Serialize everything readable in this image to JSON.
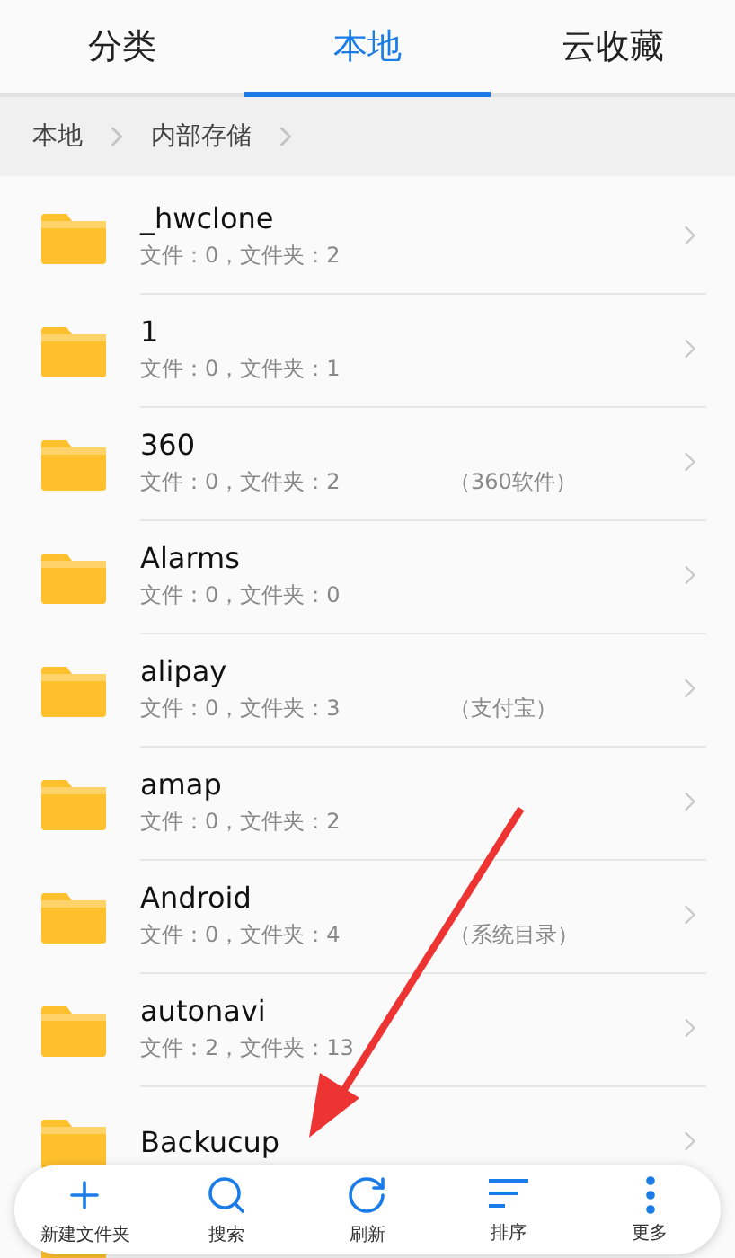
{
  "tabs": [
    {
      "label": "分类",
      "selected": false
    },
    {
      "label": "本地",
      "selected": true
    },
    {
      "label": "云收藏",
      "selected": false
    }
  ],
  "breadcrumb": [
    "本地",
    "内部存储"
  ],
  "folders": [
    {
      "name": "_hwclone",
      "info": "文件：0，文件夹：2"
    },
    {
      "name": "1",
      "info": "文件：0，文件夹：1"
    },
    {
      "name": "360",
      "info": "文件：0，文件夹：2",
      "tag": "（360软件）"
    },
    {
      "name": "Alarms",
      "info": "文件：0，文件夹：0"
    },
    {
      "name": "alipay",
      "info": "文件：0，文件夹：3",
      "tag": "（支付宝）"
    },
    {
      "name": "amap",
      "info": "文件：0，文件夹：2"
    },
    {
      "name": "Android",
      "info": "文件：0，文件夹：4",
      "tag": "（系统目录）"
    },
    {
      "name": "autonavi",
      "info": "文件：2，文件夹：13"
    },
    {
      "name": "Backucup"
    }
  ],
  "toolbar": [
    {
      "kind": "add",
      "label": "新建文件夹"
    },
    {
      "kind": "search",
      "label": "搜索"
    },
    {
      "kind": "refresh",
      "label": "刷新"
    },
    {
      "kind": "sort",
      "label": "排序"
    },
    {
      "kind": "more",
      "label": "更多"
    }
  ]
}
